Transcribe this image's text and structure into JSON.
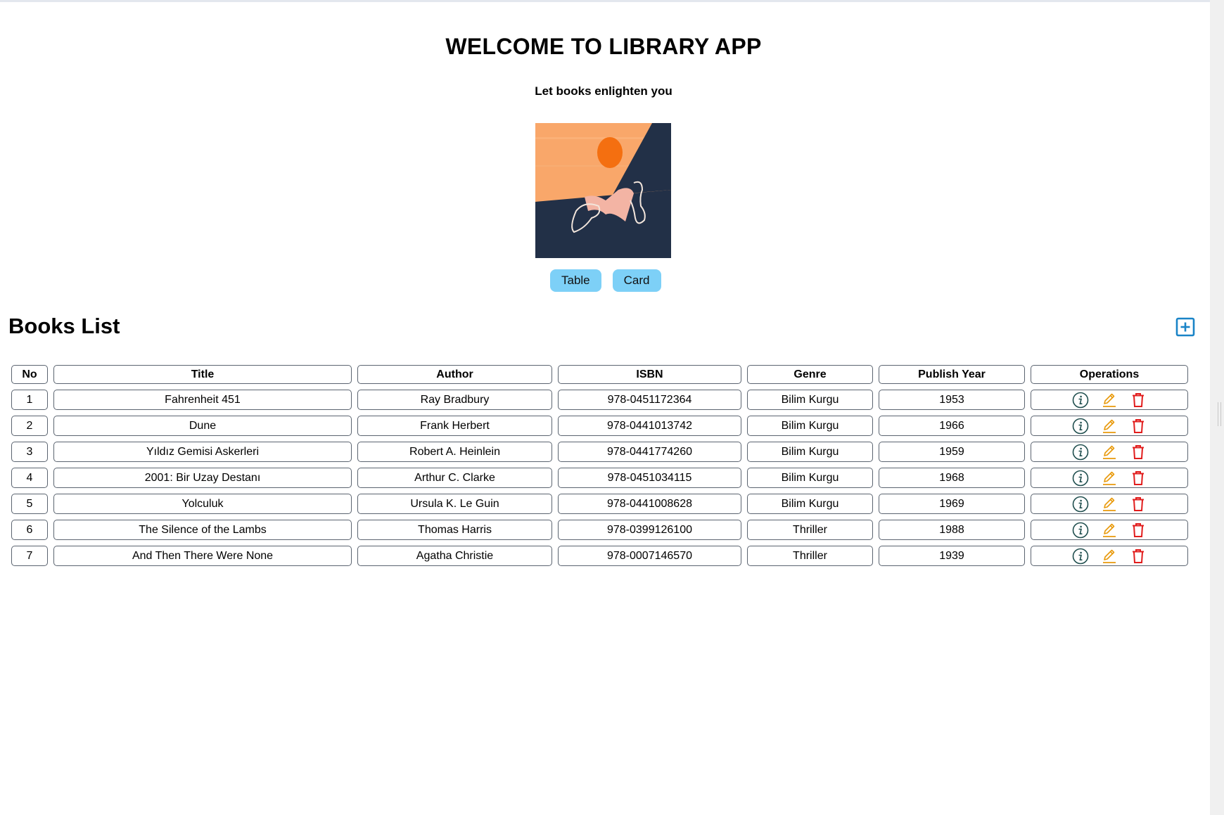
{
  "header": {
    "title": "WELCOME TO LIBRARY APP",
    "subtitle": "Let books enlighten you"
  },
  "hero_image": {
    "icon": "reading-illustration",
    "colors": {
      "sky": "#f9a76a",
      "ground": "#223047",
      "sun": "#f46f10",
      "hand": "#f3b4a4"
    }
  },
  "view_toggle": {
    "table_label": "Table",
    "card_label": "Card"
  },
  "books_section": {
    "title": "Books List",
    "add_icon": "plus-square-icon",
    "add_color": "#1a84c7"
  },
  "table": {
    "columns": [
      "No",
      "Title",
      "Author",
      "ISBN",
      "Genre",
      "Publish Year",
      "Operations"
    ],
    "rows": [
      {
        "no": "1",
        "title": "Fahrenheit 451",
        "author": "Ray Bradbury",
        "isbn": "978-0451172364",
        "genre": "Bilim Kurgu",
        "year": "1953"
      },
      {
        "no": "2",
        "title": "Dune",
        "author": "Frank Herbert",
        "isbn": "978-0441013742",
        "genre": "Bilim Kurgu",
        "year": "1966"
      },
      {
        "no": "3",
        "title": "Yıldız Gemisi Askerleri",
        "author": "Robert A. Heinlein",
        "isbn": "978-0441774260",
        "genre": "Bilim Kurgu",
        "year": "1959"
      },
      {
        "no": "4",
        "title": "2001: Bir Uzay Destanı",
        "author": "Arthur C. Clarke",
        "isbn": "978-0451034115",
        "genre": "Bilim Kurgu",
        "year": "1968"
      },
      {
        "no": "5",
        "title": "Yolculuk",
        "author": "Ursula K. Le Guin",
        "isbn": "978-0441008628",
        "genre": "Bilim Kurgu",
        "year": "1969"
      },
      {
        "no": "6",
        "title": "The Silence of the Lambs",
        "author": "Thomas Harris",
        "isbn": "978-0399126100",
        "genre": "Thriller",
        "year": "1988"
      },
      {
        "no": "7",
        "title": "And Then There Were None",
        "author": "Agatha Christie",
        "isbn": "978-0007146570",
        "genre": "Thriller",
        "year": "1939"
      }
    ],
    "operation_icons": {
      "info": {
        "icon": "info-circle-icon",
        "color": "#1f4e4e"
      },
      "edit": {
        "icon": "pencil-icon",
        "color": "#e89a0c"
      },
      "delete": {
        "icon": "trash-icon",
        "color": "#e11d1d"
      }
    }
  }
}
